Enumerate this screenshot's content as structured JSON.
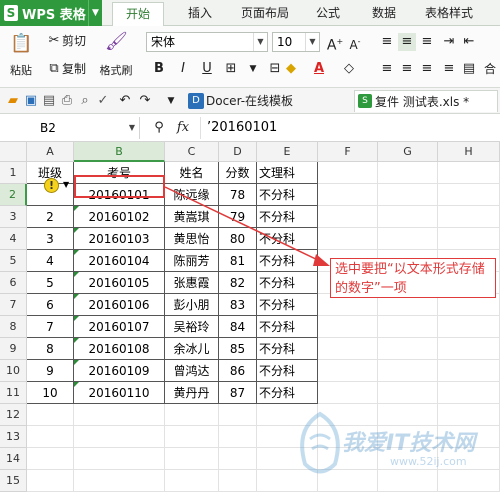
{
  "app": {
    "name": "WPS 表格",
    "logo": "S"
  },
  "ribbon_tabs": [
    "开始",
    "插入",
    "页面布局",
    "公式",
    "数据",
    "表格样式"
  ],
  "ribbon": {
    "paste": "粘贴",
    "cut": "剪切",
    "copy": "复制",
    "format_painter": "格式刷",
    "font_name": "宋体",
    "font_size": "10",
    "bold": "B",
    "italic": "I",
    "underline": "U",
    "merge_label": "合"
  },
  "doc_tabs": {
    "docer": "Docer-在线模板",
    "file": "复件 测试表.xls *"
  },
  "formula_bar": {
    "cell_ref": "B2",
    "fx": "fx",
    "value": "’20160101"
  },
  "columns": [
    "A",
    "B",
    "C",
    "D",
    "E",
    "F",
    "G",
    "H"
  ],
  "rows": [
    "1",
    "2",
    "3",
    "4",
    "5",
    "6",
    "7",
    "8",
    "9",
    "10",
    "11",
    "12",
    "13",
    "14",
    "15"
  ],
  "table": {
    "headers": [
      "班级",
      "考号",
      "姓名",
      "分数",
      "文理科"
    ],
    "data": [
      [
        "",
        "20160101",
        "陈远缘",
        "78",
        "不分科"
      ],
      [
        "2",
        "20160102",
        "黄嵩琪",
        "79",
        "不分科"
      ],
      [
        "3",
        "20160103",
        "黄思怡",
        "80",
        "不分科"
      ],
      [
        "4",
        "20160104",
        "陈丽芳",
        "81",
        "不分科"
      ],
      [
        "5",
        "20160105",
        "张惠霞",
        "82",
        "不分科"
      ],
      [
        "6",
        "20160106",
        "彭小朋",
        "83",
        "不分科"
      ],
      [
        "7",
        "20160107",
        "吴裕玲",
        "84",
        "不分科"
      ],
      [
        "8",
        "20160108",
        "余冰儿",
        "85",
        "不分科"
      ],
      [
        "9",
        "20160109",
        "曾鸿达",
        "86",
        "不分科"
      ],
      [
        "10",
        "20160110",
        "黄丹丹",
        "87",
        "不分科"
      ]
    ]
  },
  "annotation": "选中要把“以文本形式存储的数字”一项",
  "watermark": {
    "text": "我爱IT技术网",
    "url": "www.52ij.com"
  },
  "colors": {
    "accent_green": "#2f9a3d",
    "annotation_red": "#e03a3a"
  }
}
